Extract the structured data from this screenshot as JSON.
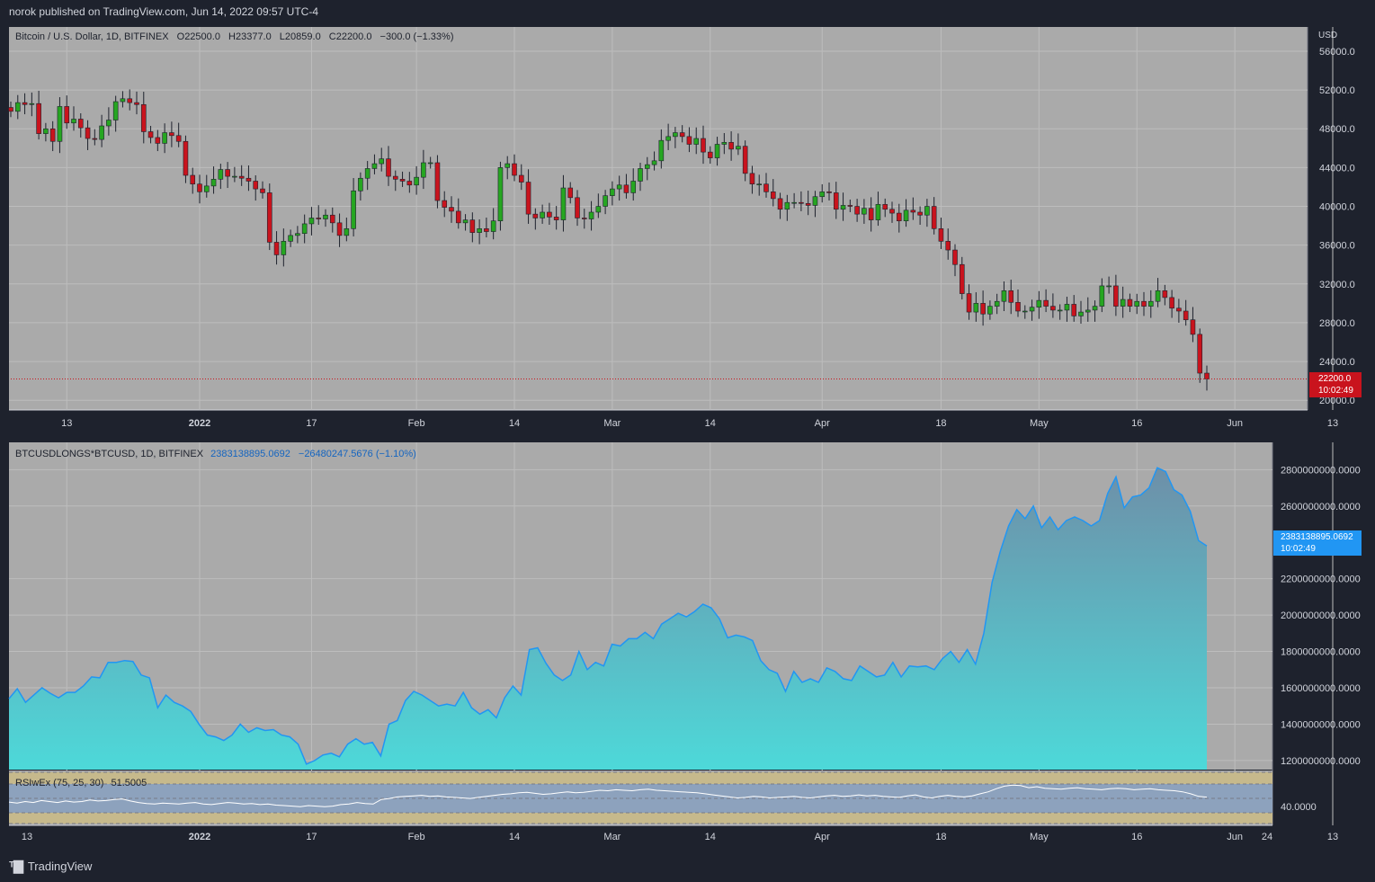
{
  "header": {
    "published": "norok published on TradingView.com, Jun 14, 2022 09:57 UTC-4"
  },
  "footer": {
    "brand": "TradingView"
  },
  "colors": {
    "bg": "#aaaaaa",
    "frame": "#1e222d",
    "up": "#26a621",
    "down": "#c9131d",
    "line": "#2196f3",
    "fill_top": "#6e8fa8",
    "fill_bottom": "#4dd9d9"
  },
  "main_pane": {
    "legend": {
      "symbol": "Bitcoin / U.S. Dollar, 1D, BITFINEX",
      "o_label": "O",
      "o": "22500.0",
      "h_label": "H",
      "h": "23377.0",
      "l_label": "L",
      "l": "20859.0",
      "c_label": "C",
      "c": "22200.0",
      "change": "−300.0 (−1.33%)"
    },
    "currency": "USD",
    "price_ticks": [
      "56000.0",
      "52000.0",
      "48000.0",
      "44000.0",
      "40000.0",
      "36000.0",
      "32000.0",
      "28000.0",
      "24000.0",
      "20000.0"
    ],
    "last_price": "22200.0",
    "countdown": "10:02:49"
  },
  "longs_pane": {
    "legend": {
      "symbol": "BTCUSDLONGS*BTCUSD, 1D, BITFINEX",
      "value": "2383138895.0692",
      "change": "−26480247.5676 (−1.10%)"
    },
    "ticks": [
      "2800000000.0000",
      "2600000000.0000",
      "2200000000.0000",
      "2000000000.0000",
      "1800000000.0000",
      "1600000000.0000",
      "1400000000.0000",
      "1200000000.0000"
    ],
    "last_value": "2383138895.0692",
    "countdown": "10:02:49"
  },
  "rsi_pane": {
    "legend": {
      "name": "RSIwEx (75, 25, 30)",
      "value": "51.5005"
    },
    "tick": "40.0000"
  },
  "time_axis_main": [
    "13",
    "2022",
    "17",
    "Feb",
    "14",
    "Mar",
    "14",
    "Apr",
    "18",
    "May",
    "16",
    "Jun",
    "13"
  ],
  "time_axis_bottom": [
    "13",
    "2022",
    "17",
    "Feb",
    "14",
    "Mar",
    "14",
    "Apr",
    "18",
    "May",
    "16",
    "Jun",
    "13",
    "24"
  ],
  "chart_data": [
    {
      "type": "candlestick",
      "title": "Bitcoin / U.S. Dollar, 1D, BITFINEX",
      "ylabel": "USD",
      "ylim": [
        19000,
        58500
      ],
      "x_start": "2021-12-05",
      "x_end": "2022-06-14",
      "closes": [
        49800,
        50700,
        50500,
        50600,
        47500,
        48000,
        46700,
        50300,
        48600,
        49000,
        48100,
        47000,
        46900,
        48300,
        48900,
        50800,
        51100,
        50700,
        50500,
        47700,
        47100,
        46500,
        47600,
        47300,
        46700,
        43200,
        42300,
        41500,
        42100,
        42800,
        43800,
        43100,
        43100,
        42900,
        42600,
        41800,
        41400,
        36300,
        35000,
        36400,
        37000,
        37200,
        38200,
        38800,
        38700,
        39100,
        38300,
        37000,
        37700,
        41600,
        42900,
        43900,
        44400,
        44900,
        43100,
        42800,
        42600,
        42200,
        43000,
        44500,
        44500,
        40600,
        39900,
        39500,
        38300,
        38600,
        37300,
        37700,
        37400,
        38500,
        44000,
        44400,
        43200,
        42500,
        39200,
        38800,
        39400,
        38900,
        38600,
        41900,
        40900,
        38800,
        38700,
        39400,
        40000,
        41100,
        41800,
        42200,
        41400,
        42600,
        43900,
        44300,
        44700,
        46800,
        47200,
        47600,
        47200,
        46400,
        47000,
        45600,
        45000,
        46400,
        46600,
        45900,
        46200,
        43400,
        42300,
        42300,
        41500,
        40800,
        39700,
        40400,
        40400,
        40300,
        40100,
        41000,
        41500,
        41400,
        39700,
        40100,
        40000,
        39200,
        39800,
        38600,
        40200,
        39700,
        39300,
        38500,
        39600,
        39400,
        39100,
        40000,
        37700,
        36400,
        35500,
        34000,
        31000,
        29100,
        30000,
        28900,
        29700,
        30200,
        31300,
        30100,
        29200,
        29200,
        29600,
        30300,
        29700,
        29300,
        29300,
        29900,
        28700,
        29100,
        29300,
        29700,
        31800,
        31800,
        29700,
        30400,
        29700,
        30200,
        29700,
        30200,
        31300,
        30600,
        29500,
        29200,
        28300,
        26800,
        22800,
        22200
      ],
      "last_close": 22200
    },
    {
      "type": "area",
      "title": "BTCUSDLONGS*BTCUSD, 1D, BITFINEX",
      "ylim": [
        1150000000,
        2950000000
      ],
      "x_start": "2021-12-05",
      "x_end": "2022-06-14",
      "values": [
        1540000000,
        1595000000,
        1520000000,
        1560000000,
        1600000000,
        1570000000,
        1545000000,
        1575000000,
        1575000000,
        1610000000,
        1660000000,
        1655000000,
        1740000000,
        1740000000,
        1750000000,
        1745000000,
        1670000000,
        1655000000,
        1490000000,
        1560000000,
        1520000000,
        1500000000,
        1470000000,
        1400000000,
        1340000000,
        1330000000,
        1310000000,
        1340000000,
        1400000000,
        1355000000,
        1380000000,
        1365000000,
        1370000000,
        1340000000,
        1330000000,
        1290000000,
        1180000000,
        1200000000,
        1230000000,
        1240000000,
        1220000000,
        1290000000,
        1320000000,
        1290000000,
        1300000000,
        1225000000,
        1400000000,
        1420000000,
        1530000000,
        1580000000,
        1560000000,
        1530000000,
        1500000000,
        1510000000,
        1500000000,
        1575000000,
        1490000000,
        1455000000,
        1480000000,
        1435000000,
        1545000000,
        1610000000,
        1560000000,
        1810000000,
        1820000000,
        1735000000,
        1670000000,
        1640000000,
        1670000000,
        1800000000,
        1700000000,
        1740000000,
        1720000000,
        1840000000,
        1830000000,
        1870000000,
        1870000000,
        1905000000,
        1870000000,
        1950000000,
        1980000000,
        2010000000,
        1990000000,
        2020000000,
        2060000000,
        2040000000,
        1980000000,
        1875000000,
        1890000000,
        1880000000,
        1860000000,
        1750000000,
        1700000000,
        1680000000,
        1580000000,
        1690000000,
        1630000000,
        1650000000,
        1630000000,
        1710000000,
        1690000000,
        1650000000,
        1640000000,
        1720000000,
        1690000000,
        1660000000,
        1670000000,
        1740000000,
        1660000000,
        1720000000,
        1715000000,
        1720000000,
        1700000000,
        1760000000,
        1800000000,
        1740000000,
        1810000000,
        1730000000,
        1900000000,
        2180000000,
        2350000000,
        2490000000,
        2580000000,
        2530000000,
        2600000000,
        2480000000,
        2540000000,
        2470000000,
        2520000000,
        2540000000,
        2520000000,
        2490000000,
        2520000000,
        2670000000,
        2760000000,
        2590000000,
        2650000000,
        2660000000,
        2700000000,
        2810000000,
        2790000000,
        2690000000,
        2660000000,
        2570000000,
        2410000000,
        2380000000
      ],
      "last_value": 2383138895.0692
    },
    {
      "type": "line",
      "title": "RSIwEx (75, 25, 30)",
      "ylim": [
        0,
        100
      ],
      "bands": [
        25,
        30,
        70,
        75
      ],
      "values": [
        42,
        40,
        43,
        41,
        45,
        43,
        41,
        44,
        42,
        43,
        46,
        44,
        45,
        47,
        48,
        44,
        41,
        39,
        38,
        40,
        39,
        38,
        40,
        41,
        38,
        37,
        39,
        41,
        40,
        38,
        39,
        37,
        38,
        36,
        35,
        34,
        33,
        35,
        34,
        33,
        34,
        37,
        38,
        41,
        39,
        38,
        47,
        49,
        52,
        53,
        54,
        55,
        53,
        54,
        52,
        51,
        50,
        49,
        51,
        53,
        55,
        57,
        58,
        60,
        61,
        59,
        57,
        58,
        60,
        62,
        60,
        61,
        63,
        65,
        64,
        66,
        65,
        64,
        66,
        67,
        65,
        64,
        63,
        62,
        61,
        60,
        58,
        56,
        54,
        52,
        50,
        51,
        53,
        52,
        50,
        51,
        52,
        53,
        51,
        50,
        52,
        54,
        55,
        53,
        54,
        56,
        54,
        55,
        53,
        52,
        51,
        54,
        56,
        52,
        50,
        53,
        55,
        53,
        52,
        54,
        58,
        62,
        68,
        73,
        75,
        74,
        70,
        72,
        69,
        68,
        67,
        69,
        70,
        68,
        67,
        66,
        68,
        69,
        68,
        66,
        67,
        68,
        66,
        65,
        64,
        62,
        58,
        53,
        51.5
      ]
    }
  ]
}
